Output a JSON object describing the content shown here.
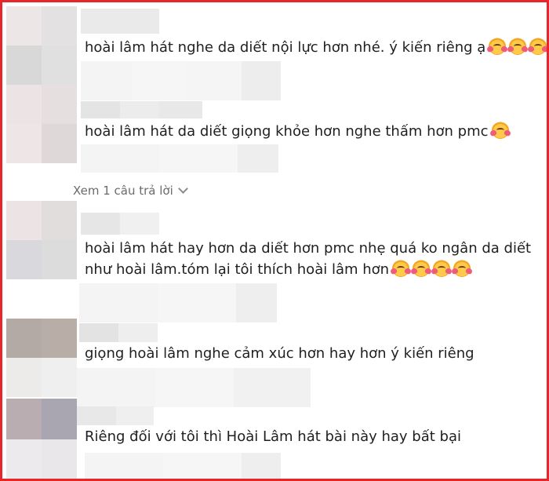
{
  "comments": [
    {
      "text": "hoài lâm hát nghe da diết nội lực hơn nhé. ý kiến riêng ạ",
      "emoji_count": 3
    },
    {
      "text": "hoài lâm hát da diết giọng khỏe hơn nghe thấm hơn pmc",
      "emoji_count": 1
    },
    {
      "text_line1": "hoài lâm hát hay hơn da diết hơn pmc nhẹ quá ko ngân da diết",
      "text_line2": "như hoài lâm.tóm lại tôi thích hoài lâm hơn",
      "emoji_count": 4
    },
    {
      "text": "giọng hoài lâm nghe cảm xúc hơn hay hơn ý kiến riêng"
    },
    {
      "text": "Riêng đối với tôi thì Hoài Lâm hát bài này hay bất bại"
    }
  ],
  "view_replies_label": "Xem 1 câu trả lời",
  "emoji_name": "smiling-face-with-hearts",
  "colors": {
    "border": "#e8262a",
    "text": "#1f1f1f",
    "muted": "#6b6b6b"
  }
}
